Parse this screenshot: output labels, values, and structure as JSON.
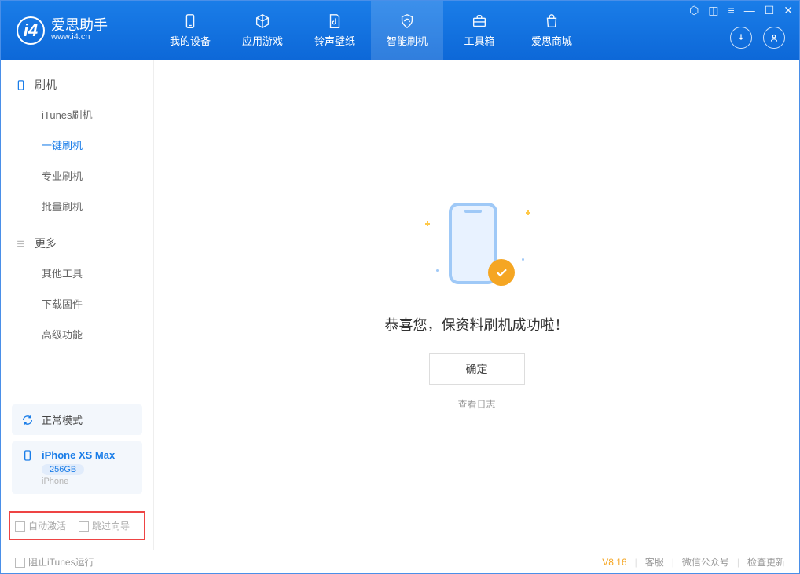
{
  "app": {
    "name_cn": "爱思助手",
    "name_en": "www.i4.cn"
  },
  "nav": {
    "items": [
      {
        "label": "我的设备"
      },
      {
        "label": "应用游戏"
      },
      {
        "label": "铃声壁纸"
      },
      {
        "label": "智能刷机"
      },
      {
        "label": "工具箱"
      },
      {
        "label": "爱思商城"
      }
    ]
  },
  "sidebar": {
    "group1": {
      "title": "刷机",
      "items": [
        "iTunes刷机",
        "一键刷机",
        "专业刷机",
        "批量刷机"
      ]
    },
    "group2": {
      "title": "更多",
      "items": [
        "其他工具",
        "下载固件",
        "高级功能"
      ]
    },
    "mode": "正常模式",
    "device": {
      "name": "iPhone XS Max",
      "storage": "256GB",
      "type": "iPhone"
    },
    "options": {
      "auto_activate": "自动激活",
      "skip_guide": "跳过向导"
    }
  },
  "main": {
    "success_msg": "恭喜您，保资料刷机成功啦！",
    "ok": "确定",
    "view_log": "查看日志"
  },
  "footer": {
    "block_itunes": "阻止iTunes运行",
    "version": "V8.16",
    "support": "客服",
    "wechat": "微信公众号",
    "update": "检查更新"
  }
}
